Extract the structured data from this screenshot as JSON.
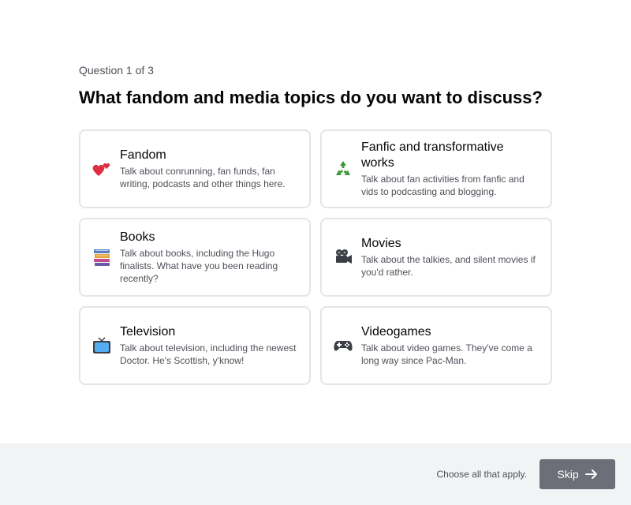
{
  "question": {
    "progress_label": "Question 1 of 3",
    "title": "What fandom and media topics do you want to discuss?"
  },
  "options": [
    {
      "title": "Fandom",
      "description": "Talk about conrunning, fan funds, fan writing, podcasts and other things here.",
      "icon": "two-hearts-icon"
    },
    {
      "title": "Fanfic and transformative works",
      "description": "Talk about fan activities from fanfic and vids to podcasting and blogging.",
      "icon": "recycle-icon"
    },
    {
      "title": "Books",
      "description": "Talk about books, including the Hugo finalists. What have you been reading recently?",
      "icon": "books-icon"
    },
    {
      "title": "Movies",
      "description": "Talk about the talkies, and silent movies if you'd rather.",
      "icon": "movie-camera-icon"
    },
    {
      "title": "Television",
      "description": "Talk about television, including the newest Doctor. He's Scottish, y'know!",
      "icon": "television-icon"
    },
    {
      "title": "Videogames",
      "description": "Talk about video games. They've come a long way since Pac-Man.",
      "icon": "game-controller-icon"
    }
  ],
  "footer": {
    "hint": "Choose all that apply.",
    "skip_label": "Skip"
  },
  "colors": {
    "card_border": "#e3e5e8",
    "footer_bg": "#f2f3f5",
    "skip_bg": "#6d6f78"
  }
}
